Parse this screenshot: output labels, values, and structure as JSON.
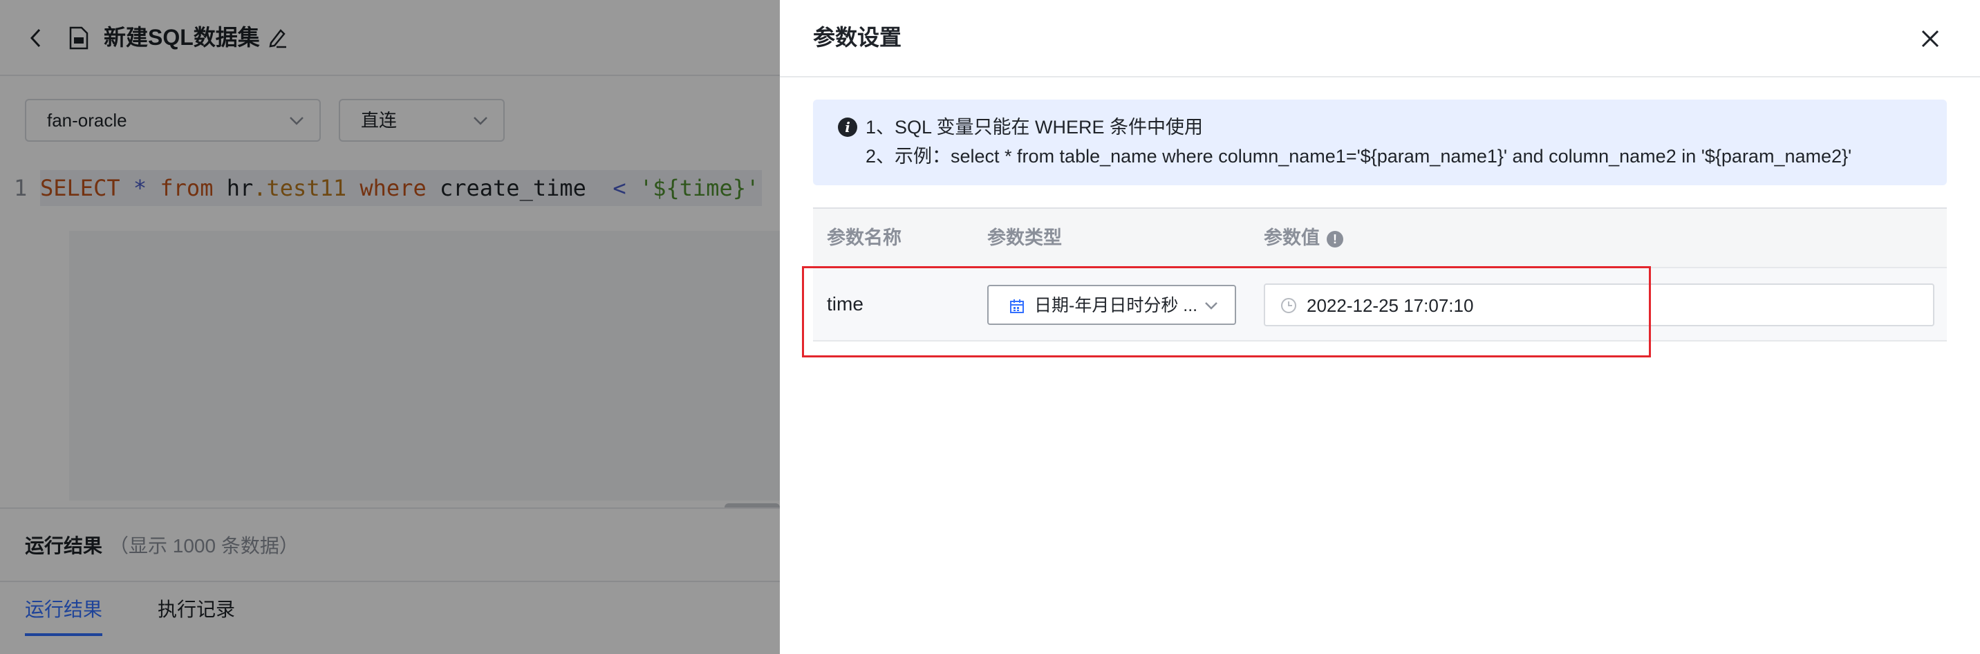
{
  "header": {
    "title": "新建SQL数据集"
  },
  "toolbar": {
    "datasource": "fan-oracle",
    "mode": "直连"
  },
  "editor": {
    "line_number": "1",
    "tokens": {
      "select": "SELECT",
      "star": "*",
      "from": "from",
      "schema": "hr",
      "table": ".test11",
      "where": "where",
      "column": "create_time",
      "lt": "<",
      "param": "'${time}'"
    }
  },
  "results": {
    "title": "运行结果",
    "subtitle": "（显示 1000 条数据）",
    "tabs": [
      "运行结果",
      "执行记录"
    ]
  },
  "drawer": {
    "title": "参数设置",
    "tip": {
      "line1": "1、SQL 变量只能在 WHERE 条件中使用",
      "line2": "2、示例：select * from table_name where column_name1='${param_name1}' and column_name2 in '${param_name2}'"
    },
    "table": {
      "headers": [
        "参数名称",
        "参数类型",
        "参数值"
      ],
      "rows": [
        {
          "name": "time",
          "type": "日期-年月日时分秒 ...",
          "value": "2022-12-25 17:07:10"
        }
      ]
    }
  },
  "colors": {
    "accent": "#3370ff",
    "highlight": "#e3262d",
    "tip_background": "#e8efff"
  }
}
